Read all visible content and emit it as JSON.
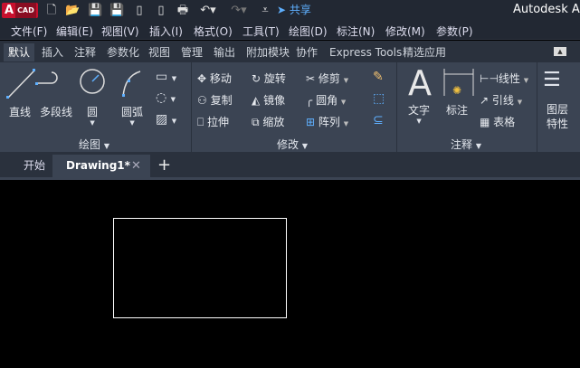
{
  "title_bar": {
    "logo_letter": "A",
    "logo_text": "CAD",
    "share_label": "共享",
    "app_title": "Autodesk Au",
    "quick_access": [
      "new-icon",
      "open-icon",
      "save-icon",
      "save-as-icon",
      "open-mobile-icon",
      "share-mobile-icon",
      "print-icon",
      "undo-icon",
      "redo-icon",
      "customize-icon"
    ]
  },
  "menu": [
    "文件(F)",
    "编辑(E)",
    "视图(V)",
    "插入(I)",
    "格式(O)",
    "工具(T)",
    "绘图(D)",
    "标注(N)",
    "修改(M)",
    "参数(P)"
  ],
  "ribbon_tabs": [
    "默认",
    "插入",
    "注释",
    "参数化",
    "视图",
    "管理",
    "输出",
    "附加模块",
    "协作",
    "Express Tools",
    "精选应用"
  ],
  "draw_panel": {
    "title": "绘图",
    "tools": [
      "直线",
      "多段线",
      "圆",
      "圆弧"
    ]
  },
  "modify_panel": {
    "title": "修改",
    "tools": [
      "移动",
      "旋转",
      "修剪",
      "复制",
      "镜像",
      "圆角",
      "拉伸",
      "缩放",
      "阵列"
    ]
  },
  "annotation_panel": {
    "title": "注释",
    "tools": [
      "文字",
      "标注",
      "线性",
      "引线",
      "表格"
    ]
  },
  "layers_panel": {
    "tool_line1": "图层",
    "tool_line2": "特性"
  },
  "doc_tabs": {
    "start": "开始",
    "drawing": "Drawing1*",
    "close": "✕",
    "add": "+"
  },
  "colors": {
    "accent_icon": "#5fb0ff",
    "logo": "#c8102e",
    "ribbon": "#3b4453",
    "canvas": "#000000"
  }
}
